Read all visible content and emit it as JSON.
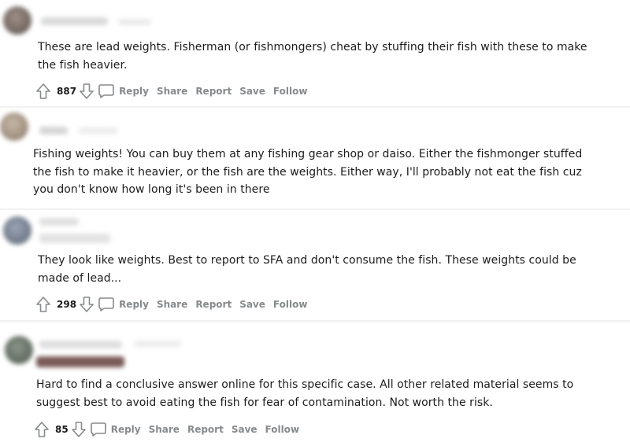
{
  "comments": [
    {
      "body": "These are lead weights. Fisherman (or fishmongers) cheat by stuffing their fish with these to make the fish heavier.",
      "votes": "887",
      "actions": {
        "reply": "Reply",
        "share": "Share",
        "report": "Report",
        "save": "Save",
        "follow": "Follow"
      }
    },
    {
      "body": "Fishing weights! You can buy them at any fishing gear shop or daiso. Either the fishmonger stuffed the fish to make it heavier, or the fish are the weights. Either way, I'll probably not eat the fish cuz you don't know how long it's been in there"
    },
    {
      "body": "They look like weights. Best to report to SFA and don't consume the fish. These weights could be made of lead...",
      "votes": "298",
      "actions": {
        "reply": "Reply",
        "share": "Share",
        "report": "Report",
        "save": "Save",
        "follow": "Follow"
      }
    },
    {
      "body": "Hard to find a conclusive answer online for this specific case. All other related material seems to suggest best to avoid eating the fish for fear of contamination. Not worth the risk.",
      "votes": "85",
      "actions": {
        "reply": "Reply",
        "share": "Share",
        "report": "Report",
        "save": "Save",
        "follow": "Follow"
      }
    }
  ],
  "icons": {
    "upvote": "upvote-arrow-icon",
    "downvote": "downvote-arrow-icon",
    "comment": "comment-bubble-icon"
  },
  "colors": {
    "action_text": "#878a8c",
    "body_text": "#1c1c1c"
  }
}
